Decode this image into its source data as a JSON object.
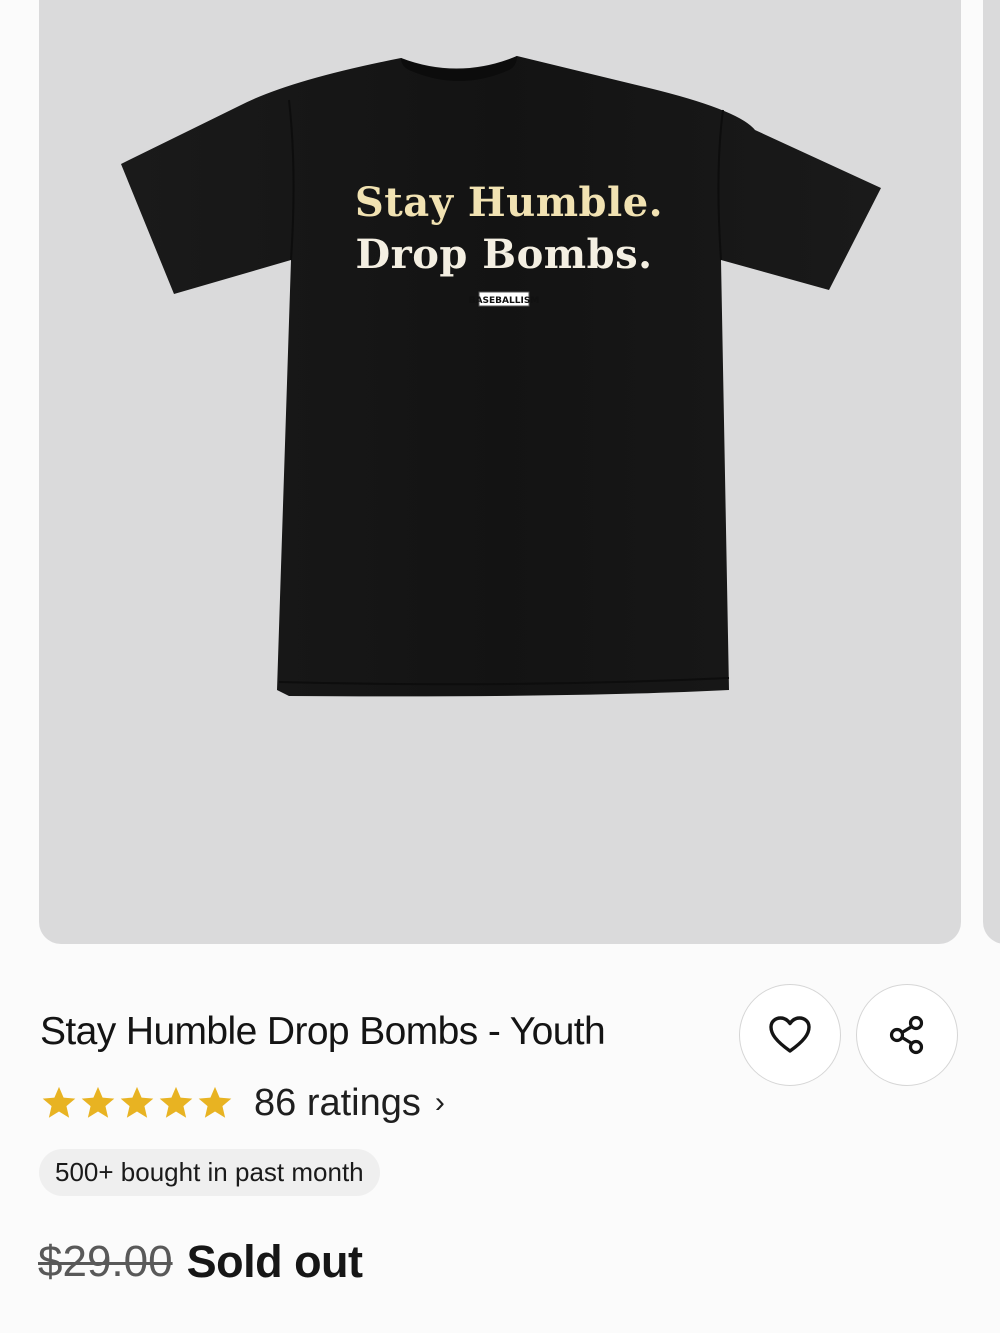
{
  "product": {
    "title": "Stay Humble Drop Bombs - Youth",
    "image": {
      "print_line1": "Stay Humble.",
      "print_line2": "Drop Bombs.",
      "brand_tag": "BASEBALLISM"
    },
    "rating": {
      "stars": 5,
      "max_stars": 5,
      "count_label": "86 ratings",
      "chevron": "›"
    },
    "badge": "500+ bought in past month",
    "price": {
      "original": "$29.00",
      "status": "Sold out"
    },
    "actions": {
      "favorite_icon": "heart-outline-icon",
      "share_icon": "share-icon"
    }
  },
  "colors": {
    "star": "#e8b322",
    "image_bg": "#dadadb",
    "shirt": "#151515",
    "print_cream": "#f1e2b2"
  }
}
